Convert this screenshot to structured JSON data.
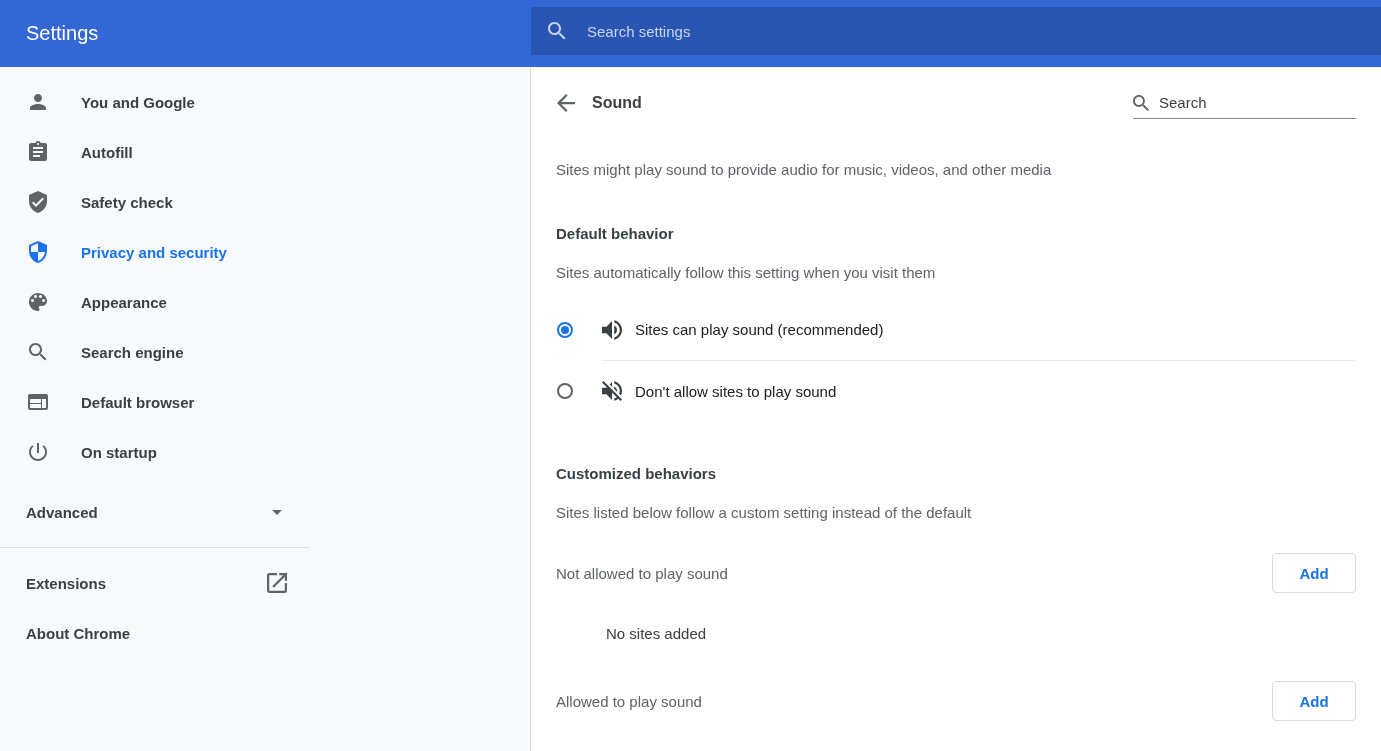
{
  "header": {
    "title": "Settings",
    "search": {
      "placeholder": "Search settings"
    }
  },
  "sidebar": {
    "items": [
      {
        "label": "You and Google",
        "selected": false
      },
      {
        "label": "Autofill",
        "selected": false
      },
      {
        "label": "Safety check",
        "selected": false
      },
      {
        "label": "Privacy and security",
        "selected": true
      },
      {
        "label": "Appearance",
        "selected": false
      },
      {
        "label": "Search engine",
        "selected": false
      },
      {
        "label": "Default browser",
        "selected": false
      },
      {
        "label": "On startup",
        "selected": false
      }
    ],
    "advanced": {
      "label": "Advanced",
      "expanded": false
    },
    "links": [
      {
        "label": "Extensions",
        "external": true
      },
      {
        "label": "About Chrome",
        "external": false
      }
    ]
  },
  "page": {
    "title": "Sound",
    "search": {
      "placeholder": "Search"
    },
    "description": "Sites might play sound to provide audio for music, videos, and other media",
    "default_behavior": {
      "title": "Default behavior",
      "subtitle": "Sites automatically follow this setting when you visit them",
      "options": [
        {
          "label": "Sites can play sound (recommended)",
          "selected": true
        },
        {
          "label": "Don't allow sites to play sound",
          "selected": false
        }
      ]
    },
    "customized_behaviors": {
      "title": "Customized behaviors",
      "subtitle": "Sites listed below follow a custom setting instead of the default",
      "lists": [
        {
          "label": "Not allowed to play sound",
          "button": "Add",
          "empty": "No sites added"
        },
        {
          "label": "Allowed to play sound",
          "button": "Add"
        }
      ]
    }
  }
}
